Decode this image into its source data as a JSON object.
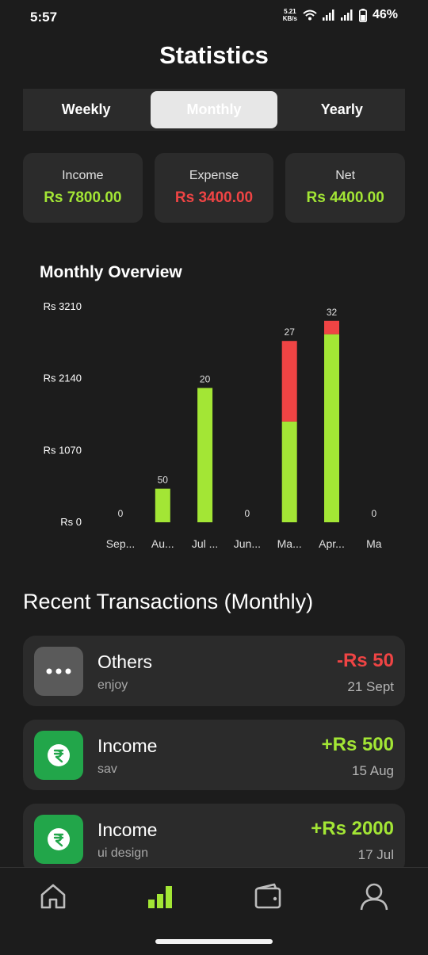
{
  "status": {
    "time": "5:57",
    "net_speed": "5.21",
    "net_unit": "KB/s",
    "battery": "46%"
  },
  "title": "Statistics",
  "tabs": [
    {
      "label": "Weekly",
      "active": false
    },
    {
      "label": "Monthly",
      "active": true
    },
    {
      "label": "Yearly",
      "active": false
    }
  ],
  "summary": {
    "income_label": "Income",
    "income_value": "Rs 7800.00",
    "expense_label": "Expense",
    "expense_value": "Rs 3400.00",
    "net_label": "Net",
    "net_value": "Rs 4400.00"
  },
  "colors": {
    "green": "#a3e635",
    "red": "#ef4444",
    "icon_green": "#22a64a",
    "icon_gray": "#5a5a5a"
  },
  "chart_title": "Monthly Overview",
  "chart_data": {
    "type": "bar",
    "stacked": true,
    "categories": [
      "Sep...",
      "Au...",
      "Jul ...",
      "Jun...",
      "Ma...",
      "Apr...",
      "Ma"
    ],
    "series": [
      {
        "color": "#a3e635",
        "values": [
          0,
          500,
          2000,
          0,
          1500,
          2800,
          0
        ]
      },
      {
        "color": "#ef4444",
        "values": [
          0,
          0,
          0,
          0,
          1200,
          200,
          0
        ]
      }
    ],
    "bar_labels": [
      "0",
      "50",
      "20",
      "0",
      "27",
      "32",
      "0"
    ],
    "y_ticks": [
      "Rs 0",
      "Rs 1070",
      "Rs 2140",
      "Rs 3210"
    ],
    "y_tick_values": [
      0,
      1070,
      2140,
      3210
    ],
    "ylim": [
      0,
      3210
    ],
    "grid": false
  },
  "transactions_title": "Recent Transactions (Monthly)",
  "transactions": [
    {
      "name": "Others",
      "note": "enjoy",
      "amount": "-Rs 50",
      "date": "21 Sept",
      "icon": "more-icon",
      "type": "expense"
    },
    {
      "name": "Income",
      "note": "sav",
      "amount": "+Rs 500",
      "date": "15 Aug",
      "icon": "rupee-icon",
      "type": "income"
    },
    {
      "name": "Income",
      "note": "ui design",
      "amount": "+Rs 2000",
      "date": "17 Jul",
      "icon": "rupee-icon",
      "type": "income"
    }
  ],
  "nav": [
    {
      "name": "home",
      "icon": "home-icon",
      "active": false
    },
    {
      "name": "stats",
      "icon": "bar-chart-icon",
      "active": true
    },
    {
      "name": "wallet",
      "icon": "wallet-icon",
      "active": false
    },
    {
      "name": "profile",
      "icon": "user-icon",
      "active": false
    }
  ]
}
